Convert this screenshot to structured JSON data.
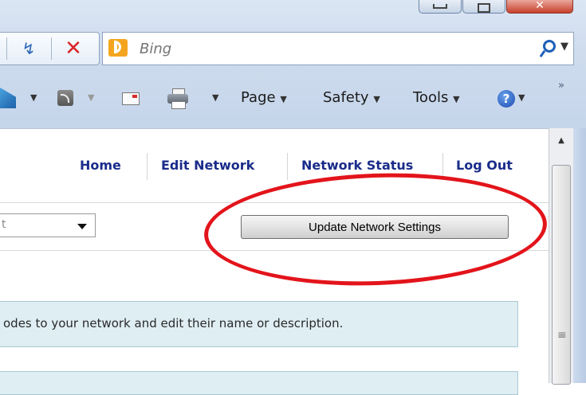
{
  "browser": {
    "search": {
      "placeholder": "Bing",
      "value": ""
    },
    "icons": {
      "refresh": "refresh-icon",
      "stop": "stop-icon",
      "search": "search-icon",
      "help": "help-icon"
    },
    "command_bar": {
      "page_label": "Page",
      "safety_label": "Safety",
      "tools_label": "Tools",
      "arrow": "▼",
      "more": "»"
    }
  },
  "site": {
    "nav": [
      {
        "label": "Home"
      },
      {
        "label": "Edit Network"
      },
      {
        "label": "Network Status"
      },
      {
        "label": "Log Out"
      }
    ],
    "select_value": "t",
    "update_button_label": "Update Network Settings",
    "info_text": "odes to your network and edit their name or description."
  },
  "colors": {
    "annotation": "#e3141b",
    "nav_link": "#1a2c8a",
    "info_bg": "#dfeef3"
  }
}
